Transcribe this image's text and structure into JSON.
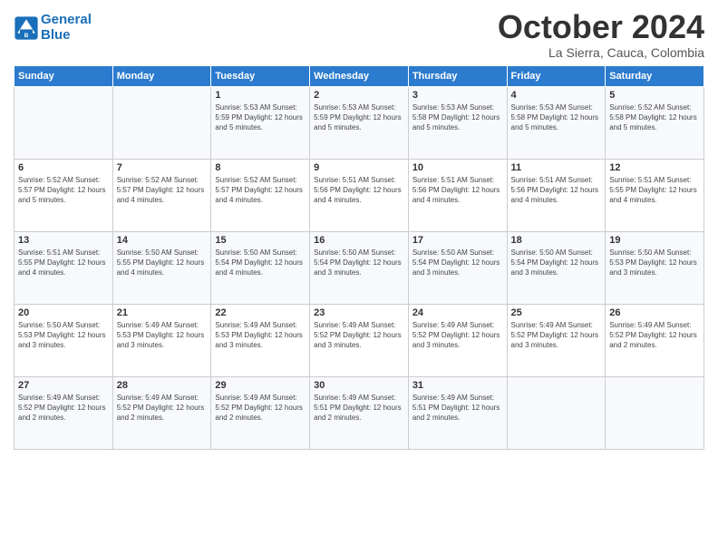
{
  "header": {
    "logo_line1": "General",
    "logo_line2": "Blue",
    "month_title": "October 2024",
    "location": "La Sierra, Cauca, Colombia"
  },
  "days_of_week": [
    "Sunday",
    "Monday",
    "Tuesday",
    "Wednesday",
    "Thursday",
    "Friday",
    "Saturday"
  ],
  "weeks": [
    [
      {
        "day": "",
        "info": ""
      },
      {
        "day": "",
        "info": ""
      },
      {
        "day": "1",
        "info": "Sunrise: 5:53 AM\nSunset: 5:59 PM\nDaylight: 12 hours\nand 5 minutes."
      },
      {
        "day": "2",
        "info": "Sunrise: 5:53 AM\nSunset: 5:59 PM\nDaylight: 12 hours\nand 5 minutes."
      },
      {
        "day": "3",
        "info": "Sunrise: 5:53 AM\nSunset: 5:58 PM\nDaylight: 12 hours\nand 5 minutes."
      },
      {
        "day": "4",
        "info": "Sunrise: 5:53 AM\nSunset: 5:58 PM\nDaylight: 12 hours\nand 5 minutes."
      },
      {
        "day": "5",
        "info": "Sunrise: 5:52 AM\nSunset: 5:58 PM\nDaylight: 12 hours\nand 5 minutes."
      }
    ],
    [
      {
        "day": "6",
        "info": "Sunrise: 5:52 AM\nSunset: 5:57 PM\nDaylight: 12 hours\nand 5 minutes."
      },
      {
        "day": "7",
        "info": "Sunrise: 5:52 AM\nSunset: 5:57 PM\nDaylight: 12 hours\nand 4 minutes."
      },
      {
        "day": "8",
        "info": "Sunrise: 5:52 AM\nSunset: 5:57 PM\nDaylight: 12 hours\nand 4 minutes."
      },
      {
        "day": "9",
        "info": "Sunrise: 5:51 AM\nSunset: 5:56 PM\nDaylight: 12 hours\nand 4 minutes."
      },
      {
        "day": "10",
        "info": "Sunrise: 5:51 AM\nSunset: 5:56 PM\nDaylight: 12 hours\nand 4 minutes."
      },
      {
        "day": "11",
        "info": "Sunrise: 5:51 AM\nSunset: 5:56 PM\nDaylight: 12 hours\nand 4 minutes."
      },
      {
        "day": "12",
        "info": "Sunrise: 5:51 AM\nSunset: 5:55 PM\nDaylight: 12 hours\nand 4 minutes."
      }
    ],
    [
      {
        "day": "13",
        "info": "Sunrise: 5:51 AM\nSunset: 5:55 PM\nDaylight: 12 hours\nand 4 minutes."
      },
      {
        "day": "14",
        "info": "Sunrise: 5:50 AM\nSunset: 5:55 PM\nDaylight: 12 hours\nand 4 minutes."
      },
      {
        "day": "15",
        "info": "Sunrise: 5:50 AM\nSunset: 5:54 PM\nDaylight: 12 hours\nand 4 minutes."
      },
      {
        "day": "16",
        "info": "Sunrise: 5:50 AM\nSunset: 5:54 PM\nDaylight: 12 hours\nand 3 minutes."
      },
      {
        "day": "17",
        "info": "Sunrise: 5:50 AM\nSunset: 5:54 PM\nDaylight: 12 hours\nand 3 minutes."
      },
      {
        "day": "18",
        "info": "Sunrise: 5:50 AM\nSunset: 5:54 PM\nDaylight: 12 hours\nand 3 minutes."
      },
      {
        "day": "19",
        "info": "Sunrise: 5:50 AM\nSunset: 5:53 PM\nDaylight: 12 hours\nand 3 minutes."
      }
    ],
    [
      {
        "day": "20",
        "info": "Sunrise: 5:50 AM\nSunset: 5:53 PM\nDaylight: 12 hours\nand 3 minutes."
      },
      {
        "day": "21",
        "info": "Sunrise: 5:49 AM\nSunset: 5:53 PM\nDaylight: 12 hours\nand 3 minutes."
      },
      {
        "day": "22",
        "info": "Sunrise: 5:49 AM\nSunset: 5:53 PM\nDaylight: 12 hours\nand 3 minutes."
      },
      {
        "day": "23",
        "info": "Sunrise: 5:49 AM\nSunset: 5:52 PM\nDaylight: 12 hours\nand 3 minutes."
      },
      {
        "day": "24",
        "info": "Sunrise: 5:49 AM\nSunset: 5:52 PM\nDaylight: 12 hours\nand 3 minutes."
      },
      {
        "day": "25",
        "info": "Sunrise: 5:49 AM\nSunset: 5:52 PM\nDaylight: 12 hours\nand 3 minutes."
      },
      {
        "day": "26",
        "info": "Sunrise: 5:49 AM\nSunset: 5:52 PM\nDaylight: 12 hours\nand 2 minutes."
      }
    ],
    [
      {
        "day": "27",
        "info": "Sunrise: 5:49 AM\nSunset: 5:52 PM\nDaylight: 12 hours\nand 2 minutes."
      },
      {
        "day": "28",
        "info": "Sunrise: 5:49 AM\nSunset: 5:52 PM\nDaylight: 12 hours\nand 2 minutes."
      },
      {
        "day": "29",
        "info": "Sunrise: 5:49 AM\nSunset: 5:52 PM\nDaylight: 12 hours\nand 2 minutes."
      },
      {
        "day": "30",
        "info": "Sunrise: 5:49 AM\nSunset: 5:51 PM\nDaylight: 12 hours\nand 2 minutes."
      },
      {
        "day": "31",
        "info": "Sunrise: 5:49 AM\nSunset: 5:51 PM\nDaylight: 12 hours\nand 2 minutes."
      },
      {
        "day": "",
        "info": ""
      },
      {
        "day": "",
        "info": ""
      }
    ]
  ]
}
